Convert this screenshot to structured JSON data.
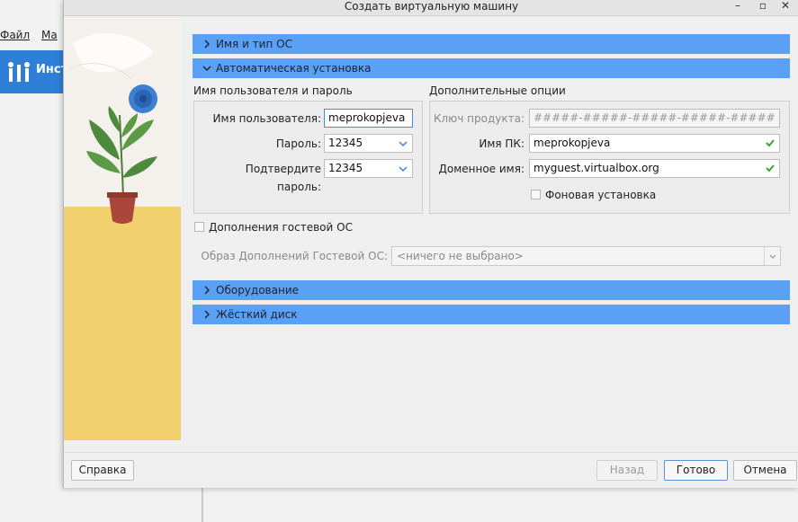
{
  "background_app": {
    "menu": [
      "Файл",
      "Ма"
    ],
    "toolbar_label": "Инст",
    "accent": "#2f7fd8"
  },
  "dialog": {
    "title": "Создать виртуальную машину",
    "window_controls": {
      "minimize": "–",
      "maximize": "▫",
      "close": "✕"
    }
  },
  "sections": {
    "name_os": "Имя и тип ОС",
    "unattended": "Автоматическая установка",
    "hardware": "Оборудование",
    "hard_disk": "Жёсткий диск",
    "color": "#5aa0f5"
  },
  "user_group": {
    "title": "Имя пользователя и пароль",
    "username_label": "Имя пользователя:",
    "username_value": "meprokopjeva",
    "password_label": "Пароль:",
    "password_value": "12345",
    "confirm_label": "Подтвердите пароль:",
    "confirm_value": "12345"
  },
  "extra_group": {
    "title": "Дополнительные опции",
    "product_key_label": "Ключ продукта:",
    "product_key_value": "#####-#####-#####-#####-#####",
    "hostname_label": "Имя ПК:",
    "hostname_value": "meprokopjeva",
    "domain_label": "Доменное имя:",
    "domain_value": "myguest.virtualbox.org",
    "background_install_label": "Фоновая установка"
  },
  "guest_additions": {
    "checkbox_label": "Дополнения гостевой ОС",
    "image_label": "Образ Дополнений Гостевой ОС:",
    "image_value": "<ничего не выбрано>"
  },
  "buttons": {
    "help": "Справка",
    "back": "Назад",
    "finish": "Готово",
    "cancel": "Отмена"
  }
}
